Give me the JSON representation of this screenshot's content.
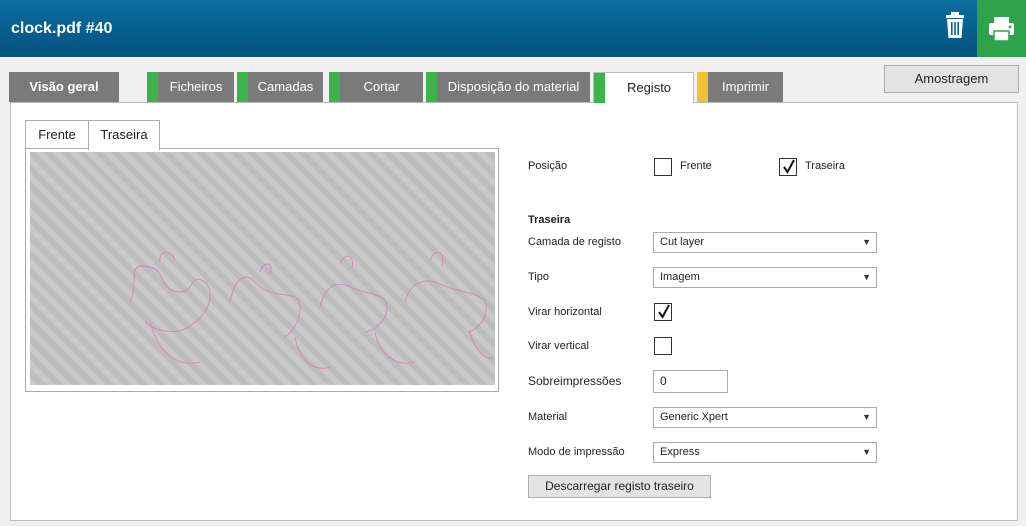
{
  "header": {
    "title": "clock.pdf #40",
    "trash_icon": "trash-icon",
    "print_icon": "printer-icon"
  },
  "tabs": [
    {
      "label": "Visão geral",
      "status_color": ""
    },
    {
      "label": "Ficheiros",
      "status_color": "#3cb44b"
    },
    {
      "label": "Camadas",
      "status_color": "#3cb44b"
    },
    {
      "label": "Cortar",
      "status_color": "#3cb44b"
    },
    {
      "label": "Disposição do material",
      "status_color": "#3cb44b"
    },
    {
      "label": "Registo",
      "status_color": "#3cb44b"
    },
    {
      "label": "Imprimir",
      "status_color": "#f2c12e"
    }
  ],
  "active_tab": "Registo",
  "sampling_button": "Amostragem",
  "preview": {
    "subtabs": [
      "Frente",
      "Traseira"
    ],
    "active_subtab": "Traseira"
  },
  "form": {
    "position": {
      "label": "Posição",
      "front_label": "Frente",
      "front_checked": false,
      "back_label": "Traseira",
      "back_checked": true
    },
    "section_title": "Traseira",
    "register_layer": {
      "label": "Camada de registo",
      "value": "Cut layer"
    },
    "type": {
      "label": "Tipo",
      "value": "Imagem"
    },
    "flip_horizontal": {
      "label": "Virar horizontal",
      "checked": true
    },
    "flip_vertical": {
      "label": "Virar vertical",
      "checked": false
    },
    "overprints": {
      "label": "Sobreimpressões",
      "value": "0"
    },
    "material": {
      "label": "Material",
      "value": "Generic Xpert"
    },
    "print_mode": {
      "label": "Modo de impressão",
      "value": "Express"
    },
    "download_button": "Descarregar registo traseiro"
  }
}
